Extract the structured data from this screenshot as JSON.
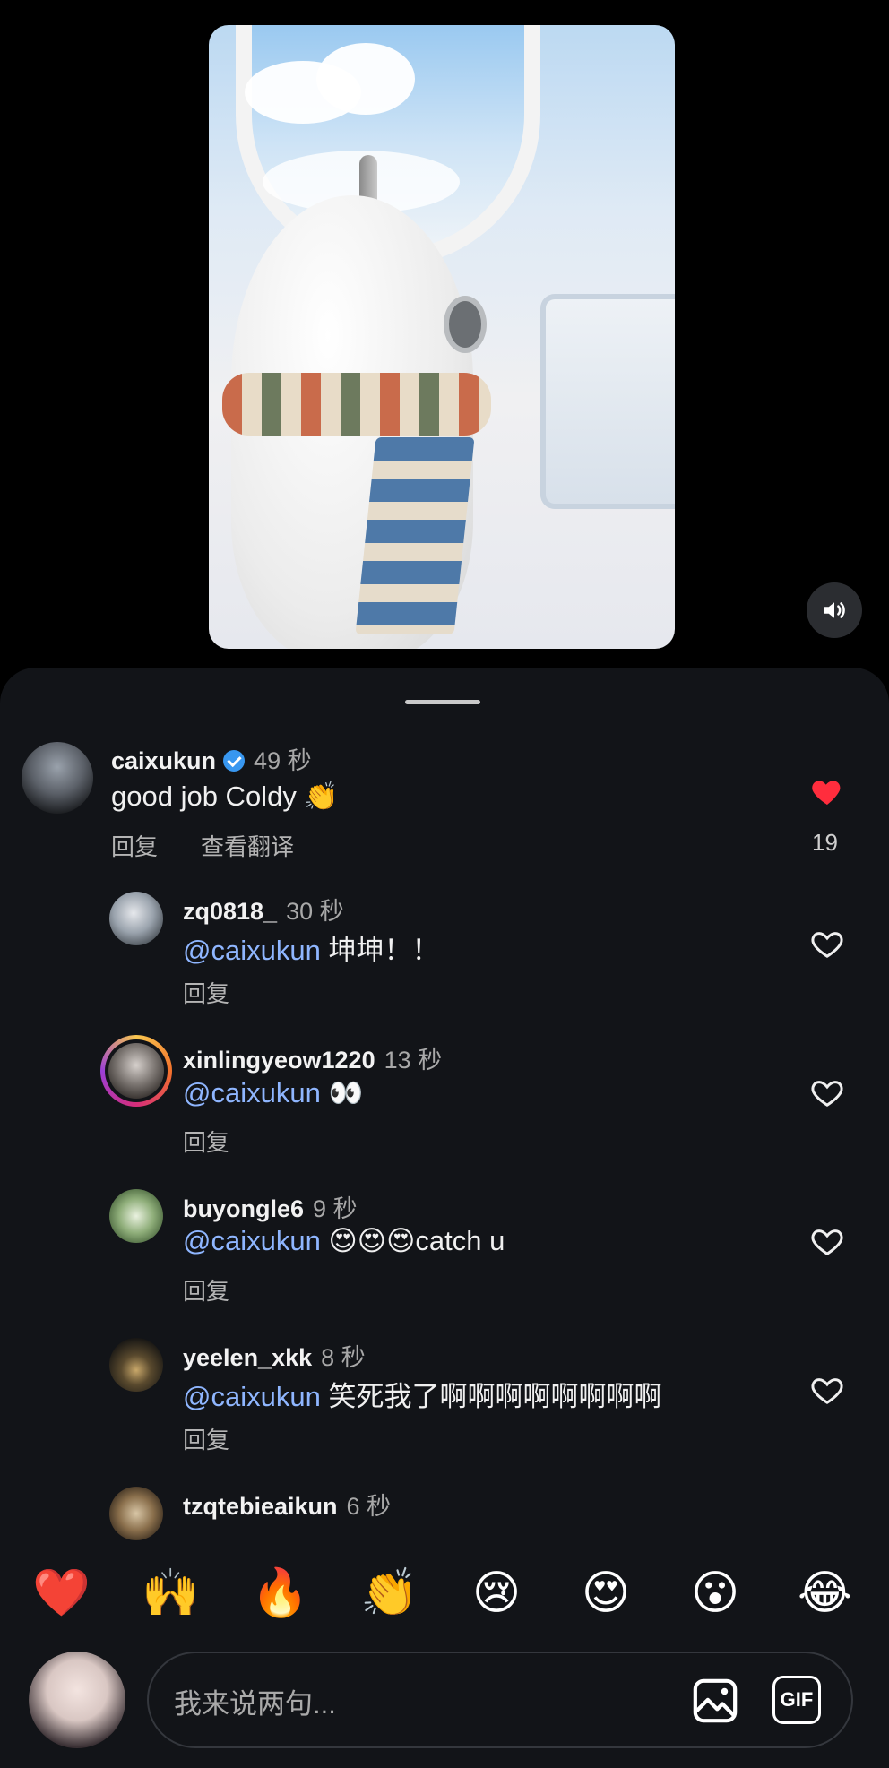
{
  "video": {
    "sound_icon": "speaker-icon"
  },
  "comments": [
    {
      "username": "caixukun",
      "verified": true,
      "time": "49 秒",
      "text": "good job Coldy 👏",
      "reply_label": "回复",
      "translate_label": "查看翻译",
      "liked": true,
      "like_count": "19"
    },
    {
      "username": "zq0818_",
      "time": "30 秒",
      "mention": "@caixukun",
      "text": " 坤坤！！",
      "reply_label": "回复"
    },
    {
      "username": "xinlingyeow1220",
      "time": "13 秒",
      "mention": "@caixukun",
      "text": " 👀",
      "reply_label": "回复"
    },
    {
      "username": "buyongle6",
      "time": "9 秒",
      "mention": "@caixukun",
      "text": " 😍😍😍catch u",
      "reply_label": "回复"
    },
    {
      "username": "yeelen_xkk",
      "time": "8 秒",
      "mention": "@caixukun",
      "text": " 笑死我了啊啊啊啊啊啊啊啊",
      "reply_label": "回复"
    },
    {
      "username": "tzqtebieaikun",
      "time": "6 秒"
    }
  ],
  "emoji_bar": [
    "❤️",
    "🙌",
    "🔥",
    "👏",
    "😢",
    "😍",
    "😮",
    "😂"
  ],
  "input": {
    "placeholder": "我来说两句...",
    "image_icon": "image-icon",
    "gif_label": "GIF"
  },
  "colors": {
    "sheet_bg": "#121418",
    "mention": "#8fb6ff",
    "like_red": "#ff2d3d",
    "verified_blue": "#3897f0"
  }
}
